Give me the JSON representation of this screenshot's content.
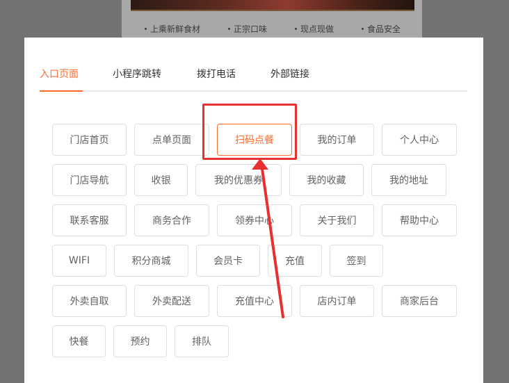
{
  "background": {
    "feature_tags": [
      "上乘新鲜食材",
      "正宗口味",
      "现点现做",
      "食品安全"
    ]
  },
  "dialog": {
    "tabs": [
      {
        "label": "入口页面",
        "active": true
      },
      {
        "label": "小程序跳转",
        "active": false
      },
      {
        "label": "拨打电话",
        "active": false
      },
      {
        "label": "外部链接",
        "active": false
      }
    ],
    "page_buttons": [
      {
        "label": "门店首页"
      },
      {
        "label": "点单页面"
      },
      {
        "label": "扫码点餐",
        "selected": true
      },
      {
        "label": "我的订单"
      },
      {
        "label": "个人中心"
      },
      {
        "label": "门店导航"
      },
      {
        "label": "收银"
      },
      {
        "label": "我的优惠券"
      },
      {
        "label": "我的收藏"
      },
      {
        "label": "我的地址"
      },
      {
        "label": "联系客服"
      },
      {
        "label": "商务合作"
      },
      {
        "label": "领券中心"
      },
      {
        "label": "关于我们"
      },
      {
        "label": "帮助中心"
      },
      {
        "label": "WIFI"
      },
      {
        "label": "积分商城"
      },
      {
        "label": "会员卡"
      },
      {
        "label": "充值"
      },
      {
        "label": "签到"
      },
      {
        "label": "外卖自取"
      },
      {
        "label": "外卖配送"
      },
      {
        "label": "充值中心"
      },
      {
        "label": "店内订单"
      },
      {
        "label": "商家后台"
      },
      {
        "label": "快餐"
      },
      {
        "label": "预约"
      },
      {
        "label": "排队"
      }
    ]
  },
  "colors": {
    "accent": "#ff6a2b",
    "annotation": "#e83030"
  }
}
